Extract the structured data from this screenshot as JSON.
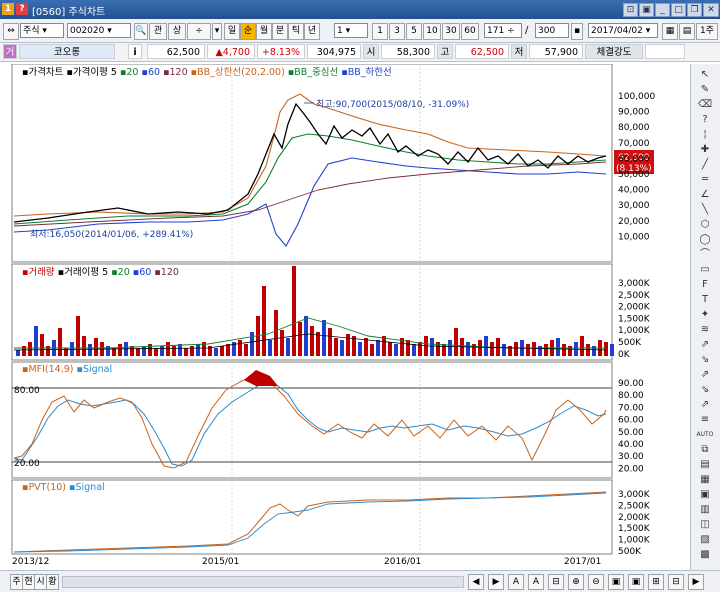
{
  "window": {
    "code": "[0560]",
    "title": "주식차트",
    "icon1": "1",
    "icon2": "?"
  },
  "toolbar": {
    "market": "주식",
    "stock_code": "002020",
    "btn_gwan": "관",
    "btn_sang": "상",
    "period_buttons": [
      "일",
      "순",
      "월",
      "분",
      "틱",
      "년"
    ],
    "interval": "1",
    "quick_numbers": [
      "1",
      "3",
      "5",
      "10",
      "30",
      "60"
    ],
    "count": "171",
    "slash": "/",
    "total": "300",
    "date": "2017/04/02",
    "page_btn": "1주"
  },
  "info": {
    "badge": "거",
    "name": "코오롱",
    "i": "i",
    "price": "62,500",
    "change": "▲4,700",
    "change_pct": "+8.13%",
    "volume": "304,975",
    "open_label": "시",
    "open": "58,300",
    "high_label": "고",
    "high": "62,500",
    "low_label": "저",
    "low": "57,900",
    "strength_label": "체결강도"
  },
  "chart": {
    "price_panel": {
      "legend": [
        {
          "label": "가격차트",
          "color": "#000000"
        },
        {
          "label": "가격이평 5",
          "color": "#000000"
        },
        {
          "label": "20",
          "color": "#0a7f2f"
        },
        {
          "label": "60",
          "color": "#1f3fd0"
        },
        {
          "label": "120",
          "color": "#7a2b40"
        },
        {
          "label": "BB_상한선(20,2.00)",
          "color": "#c8641c"
        },
        {
          "label": "BB_중심선",
          "color": "#0a7f2f"
        },
        {
          "label": "BB_하한선",
          "color": "#1f3fd0"
        }
      ],
      "high_annotation": "최고:90,700(2015/08/10, -31.09%)",
      "low_annotation": "최저:16,050(2014/01/06, +289.41%)",
      "y_ticks": [
        "100,000",
        "90,000",
        "80,000",
        "70,000",
        "60,000",
        "50,000",
        "40,000",
        "30,000",
        "20,000",
        "10,000"
      ],
      "price_tag": "62,500",
      "price_tag_pct": "(8.13%)"
    },
    "volume_panel": {
      "legend": [
        {
          "label": "거래량",
          "color": "#c00000"
        },
        {
          "label": "거래이평 5",
          "color": "#000000"
        },
        {
          "label": "20",
          "color": "#0a7f2f"
        },
        {
          "label": "60",
          "color": "#1f3fd0"
        },
        {
          "label": "120",
          "color": "#7a2b40"
        }
      ],
      "y_ticks": [
        "3,000K",
        "2,500K",
        "2,000K",
        "1,500K",
        "1,000K",
        "500K",
        "0K"
      ]
    },
    "mfi_panel": {
      "legend": [
        {
          "label": "MFI(14,9)",
          "color": "#c8641c"
        },
        {
          "label": "Signal",
          "color": "#2a8bd0"
        }
      ],
      "level_high": "80.00",
      "level_low": "20.00",
      "y_ticks": [
        "90.00",
        "80.00",
        "70.00",
        "60.00",
        "50.00",
        "40.00",
        "30.00",
        "20.00"
      ]
    },
    "pvt_panel": {
      "legend": [
        {
          "label": "PVT(10)",
          "color": "#c8641c"
        },
        {
          "label": "Signal",
          "color": "#2a8bd0"
        }
      ],
      "y_ticks": [
        "3,000K",
        "2,500K",
        "2,000K",
        "1,500K",
        "1,000K",
        "500K"
      ]
    },
    "x_ticks": [
      "2013/12",
      "2015/01",
      "2016/01",
      "2017/01"
    ]
  },
  "sidebar": {
    "icons": [
      "↖",
      "✎",
      "⌫",
      "?",
      "¦",
      "✚",
      "╱",
      "═",
      "∠",
      "╲",
      "⬡",
      "◯",
      "⌒",
      "▭",
      "F",
      "T",
      "✦",
      "≋",
      "⇗",
      "⇘",
      "⇗",
      "⇘",
      "⇗",
      "≡",
      "AUTO",
      "⧉",
      "▤",
      "▦",
      "▣",
      "▥",
      "◫",
      "▧",
      "▩"
    ]
  },
  "bottombar": {
    "tabs": [
      "주",
      "현",
      "시",
      "황"
    ],
    "tools": [
      "◀",
      "▶",
      "A",
      "A",
      "⊟",
      "⊕",
      "⊖",
      "▣",
      "▣",
      "⊞",
      "⊟",
      "▶"
    ]
  }
}
